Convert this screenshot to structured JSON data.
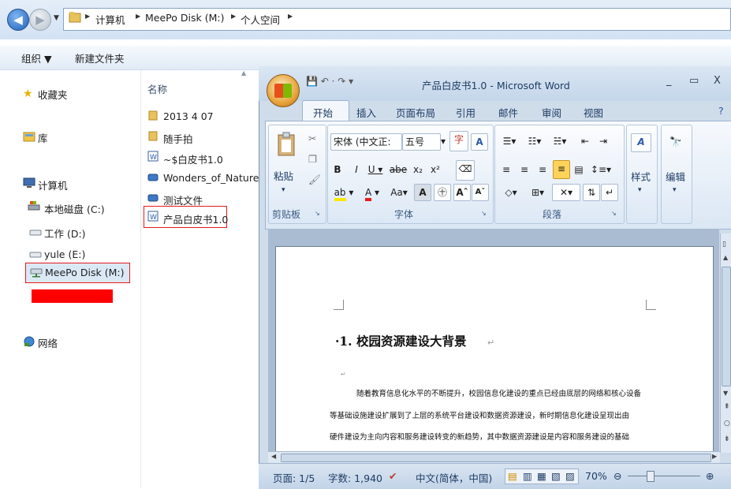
{
  "explorer": {
    "breadcrumb": [
      "计算机",
      "MeePo Disk (M:)",
      "个人空间"
    ],
    "toolbar": {
      "organize": "组织 ▼",
      "new_folder": "新建文件夹"
    },
    "column_header": "名称",
    "nav": {
      "favorites": "收藏夹",
      "libraries": "库",
      "computer": "计算机",
      "drive_c": "本地磁盘 (C:)",
      "drive_d": "工作 (D:)",
      "drive_e": "yule (E:)",
      "drive_m": "MeePo Disk (M:)",
      "network": "网络"
    },
    "files": [
      "2013 4 07",
      "随手拍",
      "~$白皮书1.0",
      "Wonders_of_Nature",
      "测试文件",
      "产品白皮书1.0"
    ]
  },
  "word": {
    "title": "产品白皮书1.0 - Microsoft Word",
    "tabs": [
      "开始",
      "插入",
      "页面布局",
      "引用",
      "邮件",
      "审阅",
      "视图"
    ],
    "clipboard": {
      "paste": "粘贴",
      "group_label": "剪贴板"
    },
    "font": {
      "name": "宋体 (中文正:",
      "size": "五号",
      "group_label": "字体"
    },
    "paragraph": {
      "group_label": "段落"
    },
    "styles": {
      "label": "样式"
    },
    "editing": {
      "label": "编辑"
    },
    "document": {
      "heading": "·1. 校园资源建设大背景",
      "lines": [
        "随着教育信息化水平的不断提升，校园信息化建设的重点已经由底层的网络和核心设备",
        "等基础设施建设扩展到了上层的系统平台建设和数据资源建设，新时期信息化建设呈现出由",
        "硬件建设为主向内容和服务建设转变的新趋势，其中数据资源建设是内容和服务建设的基础"
      ]
    },
    "status": {
      "page": "页面: 1/5",
      "words": "字数: 1,940",
      "language": "中文(简体，中国)",
      "zoom": "70%"
    }
  },
  "colors": {
    "selection_border": "#e41b1b",
    "redaction": "#ff0000"
  }
}
